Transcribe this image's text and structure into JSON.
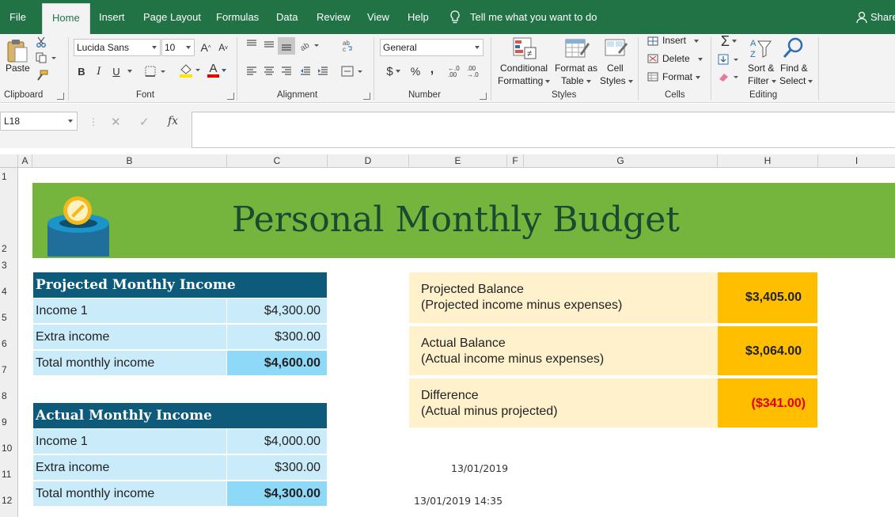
{
  "ribbon": {
    "tabs": [
      "File",
      "Home",
      "Insert",
      "Page Layout",
      "Formulas",
      "Data",
      "Review",
      "View",
      "Help"
    ],
    "tell_me": "Tell me what you want to do",
    "share": "Share",
    "clipboard": {
      "paste": "Paste",
      "label": "Clipboard"
    },
    "font": {
      "name": "Lucida Sans",
      "size": "10",
      "bold": "B",
      "italic": "I",
      "underline": "U",
      "color_letter": "A",
      "label": "Font"
    },
    "alignment": {
      "label": "Alignment"
    },
    "number": {
      "format": "General",
      "currency": "$",
      "percent": "%",
      "comma": ",",
      "inc_decimal": "←.0 .00",
      "dec_decimal": ".00 →.0",
      "label": "Number"
    },
    "styles": {
      "conditional_line1": "Conditional",
      "conditional_line2": "Formatting",
      "format_table_line1": "Format as",
      "format_table_line2": "Table",
      "cell_styles_line1": "Cell",
      "cell_styles_line2": "Styles",
      "label": "Styles"
    },
    "cells": {
      "insert": "Insert",
      "delete": "Delete",
      "format": "Format",
      "label": "Cells"
    },
    "editing": {
      "sort_line1": "Sort &",
      "sort_line2": "Filter",
      "find_line1": "Find &",
      "find_line2": "Select",
      "label": "Editing"
    }
  },
  "formula_bar": {
    "name_box": "L18",
    "fx": "fx",
    "value": ""
  },
  "columns": [
    "A",
    "B",
    "C",
    "D",
    "E",
    "F",
    "G",
    "H",
    "I"
  ],
  "rows": [
    "1",
    "2",
    "3",
    "4",
    "5",
    "6",
    "7",
    "8",
    "9",
    "10",
    "11",
    "12"
  ],
  "sheet": {
    "title": "Personal Monthly Budget",
    "projected": {
      "heading": "Projected Monthly Income",
      "rows": [
        {
          "label": "Income 1",
          "value": "$4,300.00"
        },
        {
          "label": "Extra income",
          "value": "$300.00"
        },
        {
          "label": "Total monthly income",
          "value": "$4,600.00"
        }
      ]
    },
    "actual": {
      "heading": "Actual Monthly Income",
      "rows": [
        {
          "label": "Income 1",
          "value": "$4,000.00"
        },
        {
          "label": "Extra income",
          "value": "$300.00"
        },
        {
          "label": "Total monthly income",
          "value": "$4,300.00"
        }
      ]
    },
    "balances": [
      {
        "line1": "Projected Balance",
        "line2": "(Projected income minus expenses)",
        "value": "$3,405.00"
      },
      {
        "line1": "Actual Balance",
        "line2": "(Actual income minus expenses)",
        "value": "$3,064.00"
      },
      {
        "line1": "Difference",
        "line2": "(Actual minus projected)",
        "value": "($341.00)"
      }
    ],
    "date": "13/01/2019",
    "datetime": "13/01/2019 14:35"
  },
  "colors": {
    "ribbon_green": "#217346",
    "banner_green": "#76b53d",
    "title_dark_green": "#1a4a30",
    "table_header_blue": "#0e5a7a",
    "cell_light_blue": "#c9ebfa",
    "total_blue": "#8fd9f8",
    "balance_cream": "#fff1cc",
    "balance_gold": "#ffbf00",
    "negative_red": "#e00000"
  }
}
